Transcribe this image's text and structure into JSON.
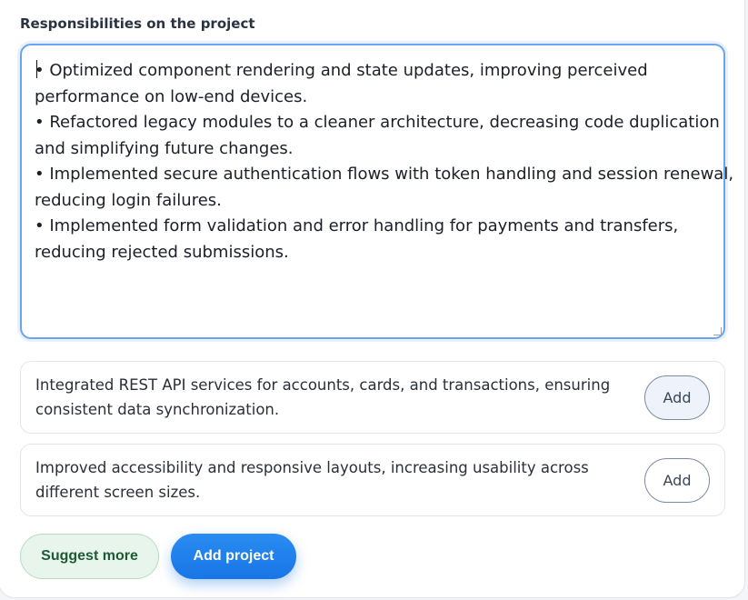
{
  "form": {
    "responsibilities_label": "Responsibilities on the project",
    "responsibilities_lines": [
      "• Optimized component rendering and state updates, improving perceived",
      "performance on low-end devices.",
      "• Refactored legacy modules to a cleaner architecture, decreasing code duplication",
      "and simplifying future changes.",
      "• Implemented secure authentication flows with token handling and session renewal,",
      "reducing login failures.",
      "• Implemented form validation and error handling for payments and transfers,",
      "reducing rejected submissions."
    ]
  },
  "suggestions": [
    {
      "text": "Integrated REST API services for accounts, cards, and transactions, ensuring consistent data synchronization.",
      "button_label": "Add"
    },
    {
      "text": "Improved accessibility and responsive layouts, increasing usability across different screen sizes.",
      "button_label": "Add"
    }
  ],
  "actions": {
    "suggest_more_label": "Suggest more",
    "add_project_label": "Add project"
  },
  "colors": {
    "focus_border": "#6aa3ee",
    "primary": "#1875e6",
    "suggest_bg": "#e7f5ec",
    "suggest_text": "#1e5a34"
  }
}
